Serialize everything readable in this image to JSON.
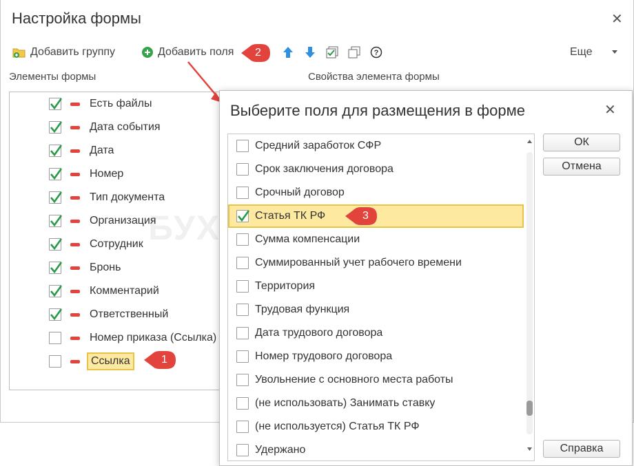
{
  "window": {
    "title": "Настройка формы",
    "close_glyph": "✕"
  },
  "toolbar": {
    "add_group": "Добавить группу",
    "add_fields": "Добавить поля",
    "more": "Еще",
    "icons": [
      "folder-add-icon",
      "plus-circle-icon",
      "arrow-up-icon",
      "arrow-down-icon",
      "check-all-icon",
      "copy-icon",
      "help-icon",
      "dropdown-arrow-icon"
    ]
  },
  "left_panel": {
    "label": "Элементы формы",
    "items": [
      {
        "label": "Есть файлы",
        "checked": true
      },
      {
        "label": "Дата события",
        "checked": true
      },
      {
        "label": "Дата",
        "checked": true
      },
      {
        "label": "Номер",
        "checked": true
      },
      {
        "label": "Тип документа",
        "checked": true
      },
      {
        "label": "Организация",
        "checked": true
      },
      {
        "label": "Сотрудник",
        "checked": true
      },
      {
        "label": "Бронь",
        "checked": true
      },
      {
        "label": "Комментарий",
        "checked": true
      },
      {
        "label": "Ответственный",
        "checked": true
      },
      {
        "label": "Номер приказа (Ссылка)",
        "checked": false
      },
      {
        "label": "Ссылка",
        "checked": false
      }
    ]
  },
  "right_panel": {
    "label": "Свойства элемента формы"
  },
  "dialog": {
    "title": "Выберите поля для размещения в форме",
    "close_glyph": "✕",
    "items": [
      {
        "label": "Средний заработок СФР",
        "checked": false
      },
      {
        "label": "Срок заключения договора",
        "checked": false
      },
      {
        "label": "Срочный договор",
        "checked": false
      },
      {
        "label": "Статья ТК РФ",
        "checked": true
      },
      {
        "label": "Сумма компенсации",
        "checked": false
      },
      {
        "label": "Суммированный учет рабочего времени",
        "checked": false
      },
      {
        "label": "Территория",
        "checked": false
      },
      {
        "label": "Трудовая функция",
        "checked": false
      },
      {
        "label": "Дата трудового договора",
        "checked": false
      },
      {
        "label": "Номер трудового договора",
        "checked": false
      },
      {
        "label": "Увольнение с основного места работы",
        "checked": false
      },
      {
        "label": "(не использовать) Занимать ставку",
        "checked": false
      },
      {
        "label": "(не используется) Статья ТК РФ",
        "checked": false
      },
      {
        "label": "Удержано",
        "checked": false
      }
    ],
    "buttons": {
      "ok": "ОК",
      "cancel": "Отмена",
      "help": "Справка"
    }
  },
  "callouts": {
    "c1": "1",
    "c2": "2",
    "c3": "3"
  },
  "watermark": "БУХЭКСПЕРТ",
  "colors": {
    "callout": "#e2443d",
    "highlight": "#fde9a0",
    "highlight_border": "#e8c34a",
    "check": "#2a9a4a",
    "minus": "#e2443d"
  }
}
